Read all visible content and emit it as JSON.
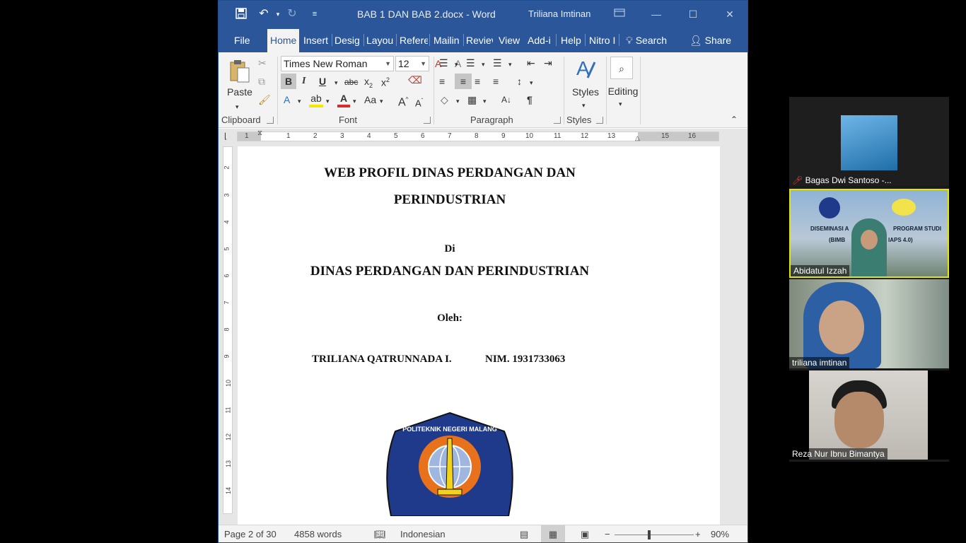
{
  "titlebar": {
    "doc_title": "BAB 1 DAN BAB 2.docx  -  Word",
    "user": "Triliana Imtinan",
    "save_icon": "save-icon",
    "undo_icon": "undo-icon",
    "redo_icon": "redo-icon"
  },
  "tabs": [
    "File",
    "Home",
    "Insert",
    "Desig",
    "Layou",
    "Refere",
    "Mailin",
    "Reviev",
    "View",
    "Add-i",
    "Help",
    "Nitro I"
  ],
  "search_label": "Search",
  "share_label": "Share",
  "ribbon": {
    "paste": "Paste",
    "font_name": "Times New Roman",
    "font_size": "12",
    "styles": "Styles",
    "editing": "Editing",
    "groups": {
      "clipboard": "Clipboard",
      "font": "Font",
      "paragraph": "Paragraph",
      "styles": "Styles"
    }
  },
  "ruler": {
    "h_numbers": [
      "1",
      "1",
      "2",
      "3",
      "4",
      "5",
      "6",
      "7",
      "8",
      "9",
      "10",
      "11",
      "12",
      "13",
      "15",
      "16"
    ],
    "v_numbers": [
      "2",
      "3",
      "4",
      "5",
      "6",
      "7",
      "8",
      "9",
      "10",
      "11",
      "12",
      "13",
      "14"
    ]
  },
  "document": {
    "title_line1": "WEB PROFIL DINAS PERDANGAN DAN",
    "title_line2": "PERINDUSTRIAN",
    "di": "Di",
    "org": "DINAS PERDANGAN DAN PERINDUSTRIAN",
    "oleh": "Oleh:",
    "author": "TRILIANA QATRUNNADA I.",
    "nim": "NIM. 1931733063",
    "logo_text": "POLITEKNIK NEGERI MALANG"
  },
  "status": {
    "page": "Page 2 of 30",
    "words": "4858 words",
    "language": "Indonesian",
    "zoom": "90%"
  },
  "participants": [
    {
      "name": "Bagas Dwi Santoso -...",
      "muted": true
    },
    {
      "name": "Abidatul Izzah"
    },
    {
      "name": "triliana imtinan"
    },
    {
      "name": "Reza Nur Ibnu Bimantya"
    }
  ],
  "banner": {
    "line1a": "DISEMINASI A",
    "line1b": "PROGRAM STUDI",
    "line2a": "(BIMB",
    "line2b": "IAPS 4.0)"
  },
  "colors": {
    "word_blue": "#2b579a",
    "ribbon_bg": "#f3f3f3",
    "active_speaker": "#e6e600"
  }
}
